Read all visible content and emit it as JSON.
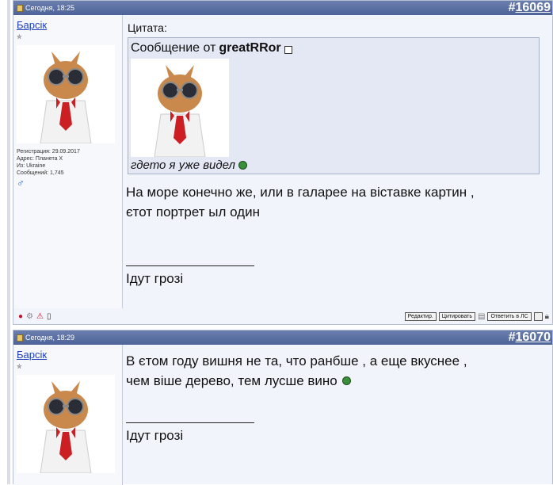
{
  "posts": [
    {
      "date": "Сегодня, 18:25",
      "number_prefix": "#",
      "number": "16069",
      "username": "Барсік",
      "rank_glyph": "✮",
      "reg_info": [
        "Регистрация: 29.09.2017",
        "Адрес: Планета X",
        "Из: Ukraine",
        "Сообщений: 1,745"
      ],
      "quote": {
        "label": "Цитата:",
        "from_prefix": "Сообщение от ",
        "author": "greatRRor",
        "text": "гдето я уже видел"
      },
      "message_lines": [
        "На море конечно же, или в галарее на віставке картин ,",
        "єтот портрет ыл один"
      ],
      "signature_line": "____________________",
      "signature": "Ідут грозі",
      "buttons": [
        "Редактир.",
        "Цитировать",
        "Ответить в ЛС"
      ]
    },
    {
      "date": "Сегодня, 18:29",
      "number_prefix": "#",
      "number": "16070",
      "username": "Барсік",
      "rank_glyph": "✮",
      "message_lines": [
        "В єтом году вишня не та, что ранбше , а еще вкуснее ,",
        "чем віше дерево, тем лусше вино"
      ],
      "signature_line": "____________________",
      "signature": "Ідут грозі"
    }
  ],
  "icons": [
    "doc-icon",
    "view-post-icon",
    "smile-icon",
    "male-icon",
    "status-icons",
    "multiquote-icon"
  ]
}
